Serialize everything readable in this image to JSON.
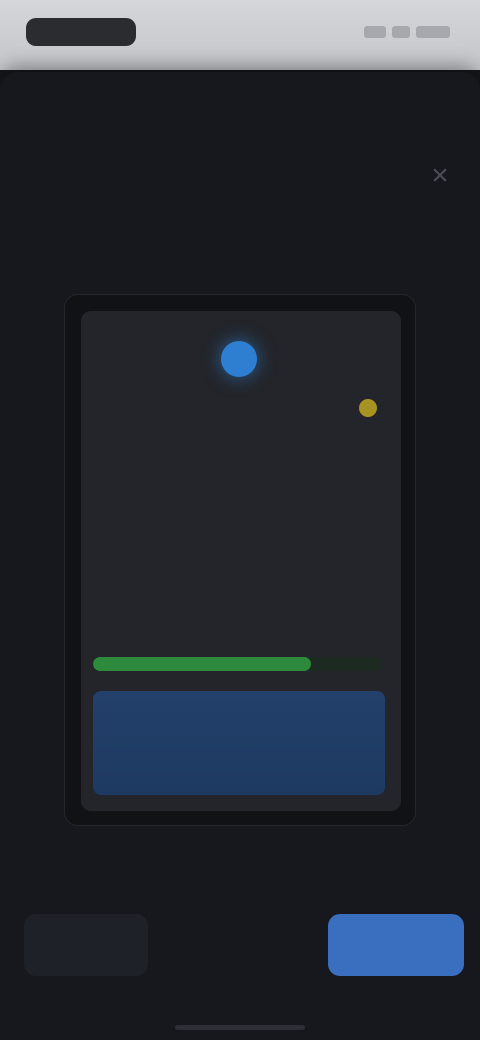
{
  "status_bar": {
    "time": ""
  },
  "sheet": {
    "title": "",
    "close_icon": "close-icon",
    "description": ""
  },
  "preview": {
    "name": "",
    "label_1": "",
    "label_2": "",
    "link": "",
    "section": "",
    "progress": 0.75,
    "cta": ""
  },
  "footer": {
    "note": "",
    "secondary_label": "",
    "tertiary_label": "",
    "primary_label": ""
  },
  "colors": {
    "accent": "#3a6fc0",
    "success": "#2d8a3d",
    "warning": "#a89422",
    "background": "#16181d"
  }
}
